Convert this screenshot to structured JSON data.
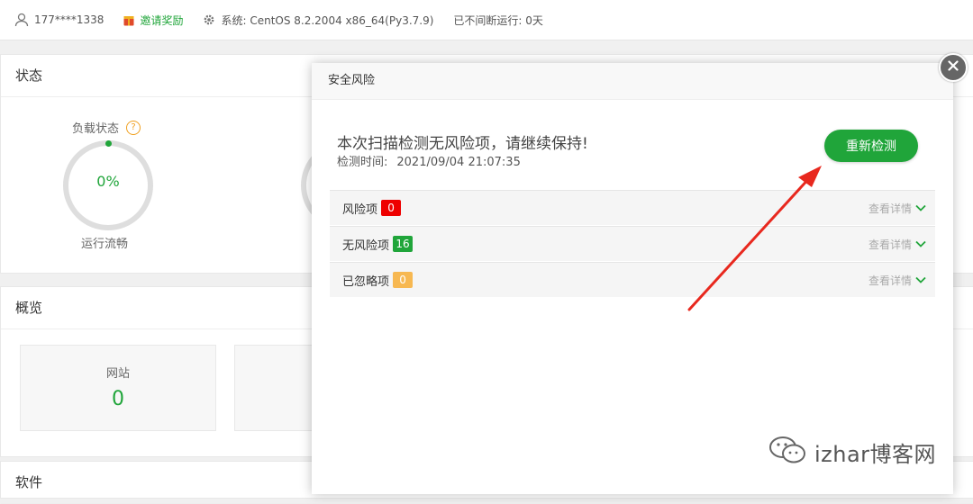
{
  "topbar": {
    "user": "177****1338",
    "invite": "邀请奖励",
    "system": "系统:  CentOS 8.2.2004 x86_64(Py3.7.9)",
    "uptime": "已不间断运行: 0天"
  },
  "status": {
    "title": "状态",
    "load_label": "负载状态",
    "help": "?",
    "load_value": "0%",
    "load_state": "运行流畅"
  },
  "overview": {
    "title": "概览",
    "cards": [
      {
        "label": "网站",
        "value": "0"
      }
    ]
  },
  "software": {
    "title": "软件"
  },
  "dialog": {
    "title": "安全风险",
    "message": "本次扫描检测无风险项，请继续保持!",
    "time_label": "检测时间:",
    "time_value": "2021/09/04 21:07:35",
    "recheck_label": "重新检测",
    "rows": [
      {
        "label": "风险项",
        "count": "0",
        "color": "#ee0000",
        "detail": "查看详情"
      },
      {
        "label": "无风险项",
        "count": "16",
        "color": "#20a53a",
        "detail": "查看详情"
      },
      {
        "label": "已忽略项",
        "count": "0",
        "color": "#f7b851",
        "detail": "查看详情"
      }
    ]
  },
  "watermark": {
    "text": "izhar博客网",
    "icon": "wechat-icon"
  },
  "colors": {
    "accent": "#20a53a",
    "danger": "#ee0000",
    "warning": "#f7b851",
    "arrow": "#e8281e"
  }
}
